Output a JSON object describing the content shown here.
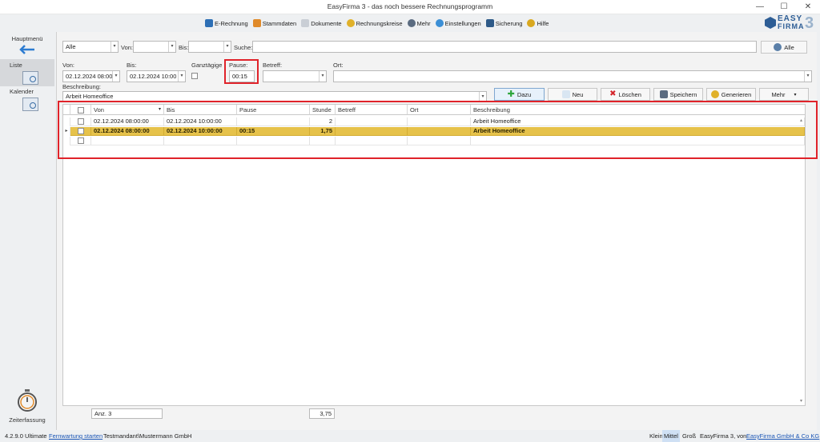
{
  "window": {
    "title": "EasyFirma 3 - das noch bessere Rechnungsprogramm"
  },
  "menu": [
    {
      "label": "E-Rechnung",
      "icon": "e-invoice-icon",
      "color": "#2d6fb5"
    },
    {
      "label": "Stammdaten",
      "icon": "people-icon",
      "color": "#e08a2a"
    },
    {
      "label": "Dokumente",
      "icon": "document-icon",
      "color": "#9aa4b0"
    },
    {
      "label": "Rechnungskreise",
      "icon": "circle-icon",
      "color": "#e0b12a"
    },
    {
      "label": "Mehr",
      "icon": "more-icon",
      "color": "#5a6b80"
    },
    {
      "label": "Einstellungen",
      "icon": "gear-icon",
      "color": "#3b8fd6"
    },
    {
      "label": "Sicherung",
      "icon": "backup-icon",
      "color": "#2e5a88"
    },
    {
      "label": "Hilfe",
      "icon": "help-icon",
      "color": "#d9a81f"
    }
  ],
  "logo": {
    "line1": "EASY",
    "line2": "FIRMA",
    "number": "3"
  },
  "sidebar": {
    "home": "Hauptmenü",
    "items": [
      {
        "label": "Liste"
      },
      {
        "label": "Kalender"
      }
    ],
    "bottom": "Zeiterfassung"
  },
  "filter": {
    "scope": "Alle",
    "von_label": "Von:",
    "bis_label": "Bis:",
    "suche_label": "Suche:",
    "alle_button": "Alle"
  },
  "form": {
    "von_label": "Von:",
    "von_value": "02.12.2024 08:00",
    "bis_label": "Bis:",
    "bis_value": "02.12.2024 10:00",
    "ganztaegig_label": "Ganztägige",
    "pause_label": "Pause:",
    "pause_value": "00:15",
    "betreff_label": "Betreff:",
    "ort_label": "Ort:",
    "beschreibung_label": "Beschreibung:",
    "beschreibung_value": "Arbeit Homeoffice"
  },
  "buttons": {
    "dazu": "Dazu",
    "neu": "Neu",
    "loeschen": "Löschen",
    "speichern": "Speichern",
    "generieren": "Generieren",
    "mehr": "Mehr"
  },
  "grid": {
    "columns": [
      "Von",
      "Bis",
      "Pause",
      "Stunde",
      "Betreff",
      "Ort",
      "Beschreibung"
    ],
    "rows": [
      {
        "von": "02.12.2024 08:00:00",
        "bis": "02.12.2024 10:00:00",
        "pause": "",
        "stunde": "2",
        "betreff": "",
        "ort": "",
        "beschreibung": "Arbeit Homeoffice"
      },
      {
        "von": "02.12.2024 08:00:00",
        "bis": "02.12.2024 10:00:00",
        "pause": "00:15",
        "stunde": "1,75",
        "betreff": "",
        "ort": "",
        "beschreibung": "Arbeit Homeoffice"
      }
    ],
    "count": "Anz. 3",
    "sum": "3,75"
  },
  "status": {
    "version": "4.2.9.0 Ultimate",
    "link": "Fernwartung starten",
    "tenant": "Testmandant\\Mustermann GmbH",
    "size_small": "Klein",
    "size_mid": "Mittel",
    "size_large": "Groß",
    "by": "EasyFirma 3, von",
    "company": "EasyFirma GmbH & Co KG"
  },
  "colors": {
    "selection": "#e6c24a",
    "highlight": "#e0232a",
    "accent": "#2d5d95"
  }
}
